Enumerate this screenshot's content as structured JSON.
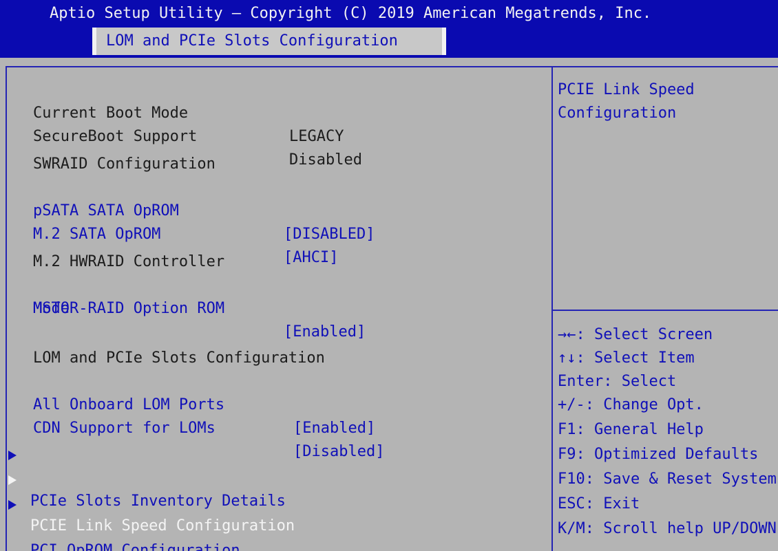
{
  "header": {
    "title": "Aptio Setup Utility – Copyright (C) 2019 American Megatrends, Inc.",
    "active_tab": "LOM and PCIe Slots Configuration"
  },
  "main": {
    "info": {
      "boot_mode_label": "Current Boot Mode",
      "boot_mode_value": "LEGACY",
      "secureboot_label": "SecureBoot Support",
      "secureboot_value": "Disabled"
    },
    "swraid": {
      "heading": "SWRAID Configuration",
      "psata_label": "pSATA SATA OpROM",
      "psata_value": "[DISABLED]",
      "m2sata_label": "M.2 SATA OpROM",
      "m2sata_value": "[AHCI]"
    },
    "hwraid": {
      "heading": "M.2 HWRAID Controller",
      "mstor_label_line1": "MSTOR-RAID Option ROM",
      "mstor_label_line2": "Mode",
      "mstor_value": "[Enabled]"
    },
    "lom": {
      "heading": "LOM and PCIe Slots Configuration",
      "onboard_label": "All Onboard LOM Ports",
      "onboard_value": "[Enabled]",
      "cdn_label": "CDN Support for LOMs",
      "cdn_value": "[Disabled]"
    },
    "submenus": [
      {
        "label": "PCIe Slots Inventory Details"
      },
      {
        "label": "PCIE Link Speed Configuration"
      },
      {
        "label": "PCI OpROM Configuration"
      }
    ]
  },
  "help": {
    "line1": "PCIE Link Speed",
    "line2": "Configuration"
  },
  "keys": [
    "→←: Select Screen",
    "↑↓: Select Item",
    "Enter: Select",
    "+/-: Change Opt.",
    "F1: General Help",
    "F9: Optimized Defaults",
    "F10: Save & Reset System",
    "ESC: Exit",
    "K/M: Scroll help UP/DOWN"
  ],
  "colors": {
    "header_bg": "#0a0ab0",
    "panel_bg": "#b4b4b4",
    "option_text": "#1010b8",
    "selected_text": "#f4f4f4"
  }
}
